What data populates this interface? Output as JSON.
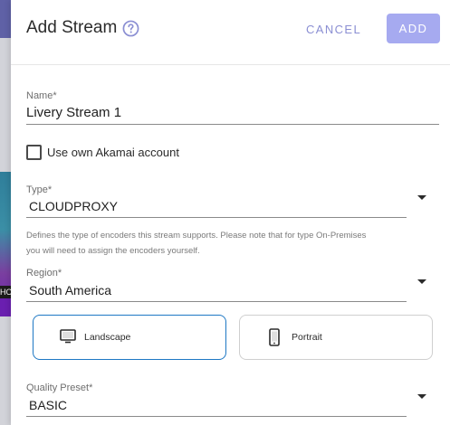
{
  "background": {
    "peek_label": "HO"
  },
  "dialog": {
    "title": "Add Stream",
    "cancel_label": "CANCEL",
    "add_label": "ADD"
  },
  "form": {
    "name": {
      "label": "Name*",
      "value": "Livery Stream 1"
    },
    "own_akamai": {
      "label": "Use own Akamai account",
      "checked": false
    },
    "type": {
      "label": "Type*",
      "value": "CLOUDPROXY",
      "helper_line1": "Defines the type of encoders this stream supports. Please note that for type On-Premises",
      "helper_line2": "you will need to assign the encoders yourself."
    },
    "region": {
      "label": "Region*",
      "value": "South America"
    },
    "orientation": {
      "landscape_label": "Landscape",
      "portrait_label": "Portrait",
      "selected": "Landscape"
    },
    "quality": {
      "label": "Quality Preset*",
      "value": "BASIC"
    }
  },
  "colors": {
    "accent": "#8b8fd3",
    "add_button_bg": "#a6aaf0",
    "selected_border": "#1e78c4"
  },
  "icons": {
    "help": "help-circle-icon",
    "dropdown": "caret-down-icon",
    "landscape": "monitor-icon",
    "portrait": "phone-icon"
  }
}
